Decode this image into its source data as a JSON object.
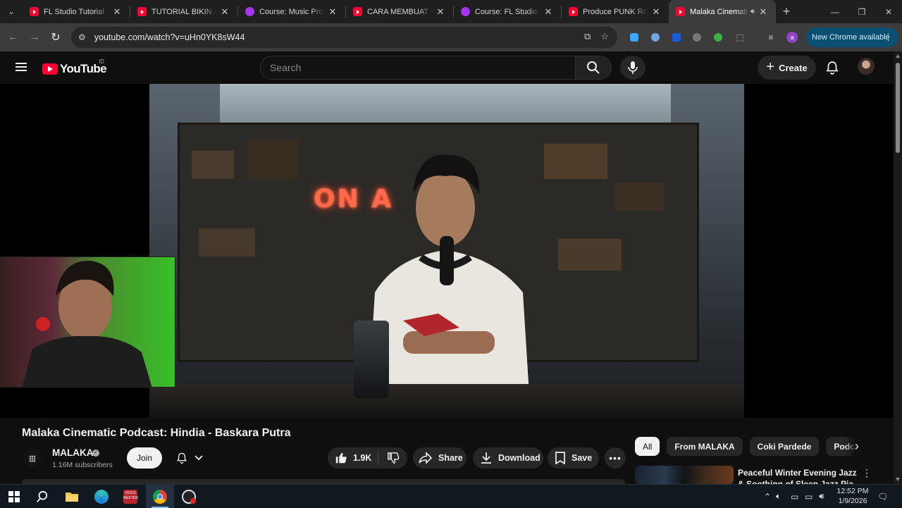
{
  "browser": {
    "tabs": [
      {
        "title": "FL Studio Tutorial - C",
        "icon": "youtube-icon"
      },
      {
        "title": "TUTORIAL BIKIN LAG",
        "icon": "youtube-icon"
      },
      {
        "title": "Course: Music Produ",
        "icon": "udemy-icon"
      },
      {
        "title": "CARA MEMBUAT MU",
        "icon": "youtube-icon"
      },
      {
        "title": "Course: FL Studio Int",
        "icon": "udemy-icon"
      },
      {
        "title": "Produce PUNK ROCK",
        "icon": "youtube-icon"
      },
      {
        "title": "Malaka Cinemati",
        "icon": "youtube-icon",
        "active": true,
        "audio": true
      }
    ],
    "url": "youtube.com/watch?v=uHn0YK8sW44",
    "update_label": "New Chrome available",
    "profile_initial": "a"
  },
  "youtube": {
    "region": "ID",
    "logo_text": "YouTube",
    "search_placeholder": "Search",
    "create_label": "Create"
  },
  "video": {
    "overlay_sign": "ON A",
    "title": "Malaka Cinematic Podcast: Hindia - Baskara Putra",
    "channel": "MALAKA",
    "subscribers": "1.16M subscribers",
    "join_label": "Join",
    "likes": "1.9K",
    "share_label": "Share",
    "download_label": "Download",
    "save_label": "Save"
  },
  "sidebar": {
    "chips": [
      "All",
      "From MALAKA",
      "Coki Pardede",
      "Podcasts"
    ],
    "recommendation": {
      "title": "Peaceful Winter Evening Jazz & Soothing of Sleep Jazz Pia"
    }
  },
  "taskbar": {
    "voicemeeter_label": "VOICE\nMEETER",
    "time": "12:52 PM",
    "date": "1/9/2026"
  },
  "colors": {
    "youtube_red": "#ff0033",
    "background": "#0f0f0f",
    "chip_selected": "#f1f1f1",
    "update_pill": "#0b4f72"
  }
}
